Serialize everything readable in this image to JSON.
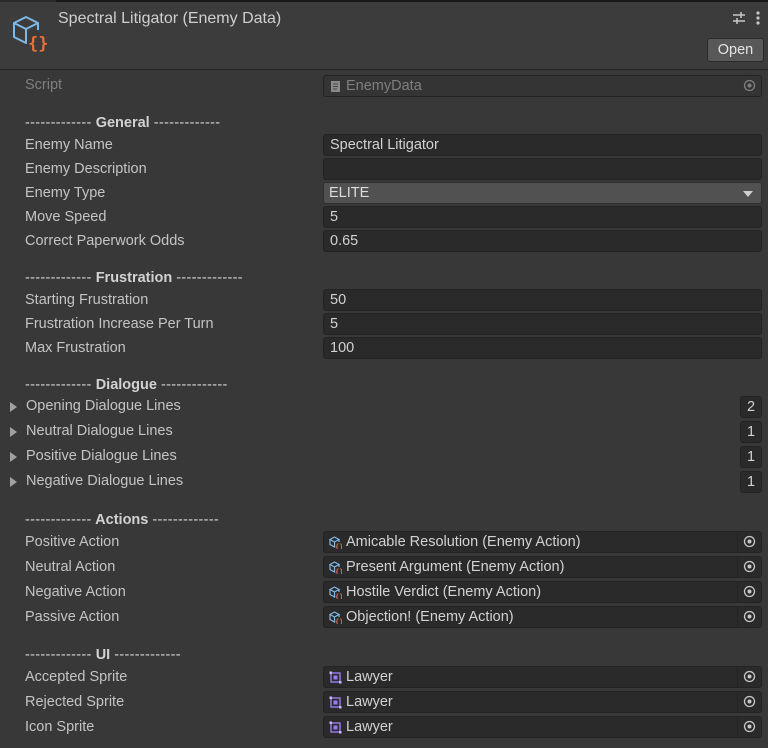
{
  "header": {
    "title": "Spectral Litigator (Enemy Data)",
    "open_label": "Open"
  },
  "script_row": {
    "label": "Script",
    "value": "EnemyData"
  },
  "general": {
    "heading_dash_left": "-------------",
    "heading": "General",
    "heading_dash_right": "-------------",
    "enemy_name": {
      "label": "Enemy Name",
      "value": "Spectral Litigator"
    },
    "enemy_description": {
      "label": "Enemy Description",
      "value": ""
    },
    "enemy_type": {
      "label": "Enemy Type",
      "value": "ELITE"
    },
    "move_speed": {
      "label": "Move Speed",
      "value": "5"
    },
    "paperwork_odds": {
      "label": "Correct Paperwork Odds",
      "value": "0.65"
    }
  },
  "frustration": {
    "heading_dash_left": "-------------",
    "heading": "Frustration",
    "heading_dash_right": "-------------",
    "starting": {
      "label": "Starting Frustration",
      "value": "50"
    },
    "increase": {
      "label": "Frustration Increase Per Turn",
      "value": "5"
    },
    "max": {
      "label": "Max Frustration",
      "value": "100"
    }
  },
  "dialogue": {
    "heading_dash_left": "-------------",
    "heading": "Dialogue",
    "heading_dash_right": "-------------",
    "opening": {
      "label": "Opening Dialogue Lines",
      "count": "2"
    },
    "neutral": {
      "label": "Neutral Dialogue Lines",
      "count": "1"
    },
    "positive": {
      "label": "Positive Dialogue Lines",
      "count": "1"
    },
    "negative": {
      "label": "Negative Dialogue Lines",
      "count": "1"
    }
  },
  "actions": {
    "heading_dash_left": "-------------",
    "heading": "Actions",
    "heading_dash_right": "-------------",
    "positive": {
      "label": "Positive Action",
      "value": "Amicable Resolution (Enemy Action)"
    },
    "neutral": {
      "label": "Neutral Action",
      "value": "Present Argument (Enemy Action)"
    },
    "negative": {
      "label": "Negative Action",
      "value": "Hostile Verdict (Enemy Action)"
    },
    "passive": {
      "label": "Passive Action",
      "value": "Objection! (Enemy Action)"
    }
  },
  "ui": {
    "heading_dash_left": "-------------",
    "heading": "UI",
    "heading_dash_right": "-------------",
    "accepted": {
      "label": "Accepted Sprite",
      "value": "Lawyer"
    },
    "rejected": {
      "label": "Rejected Sprite",
      "value": "Lawyer"
    },
    "icon": {
      "label": "Icon Sprite",
      "value": "Lawyer"
    }
  },
  "icons": {
    "asset": "scriptable-object-icon",
    "settings": "settings-sliders-icon",
    "menu": "kebab-menu-icon",
    "script": "script-file-icon",
    "action": "enemy-action-asset-icon",
    "sprite": "sprite-icon",
    "picker": "object-picker-icon"
  },
  "colors": {
    "bg": "#383838",
    "field": "#2a2a2a",
    "accent_blue": "#4ea0e0",
    "accent_orange": "#e8703a",
    "sprite_purple": "#9b7cf0"
  }
}
